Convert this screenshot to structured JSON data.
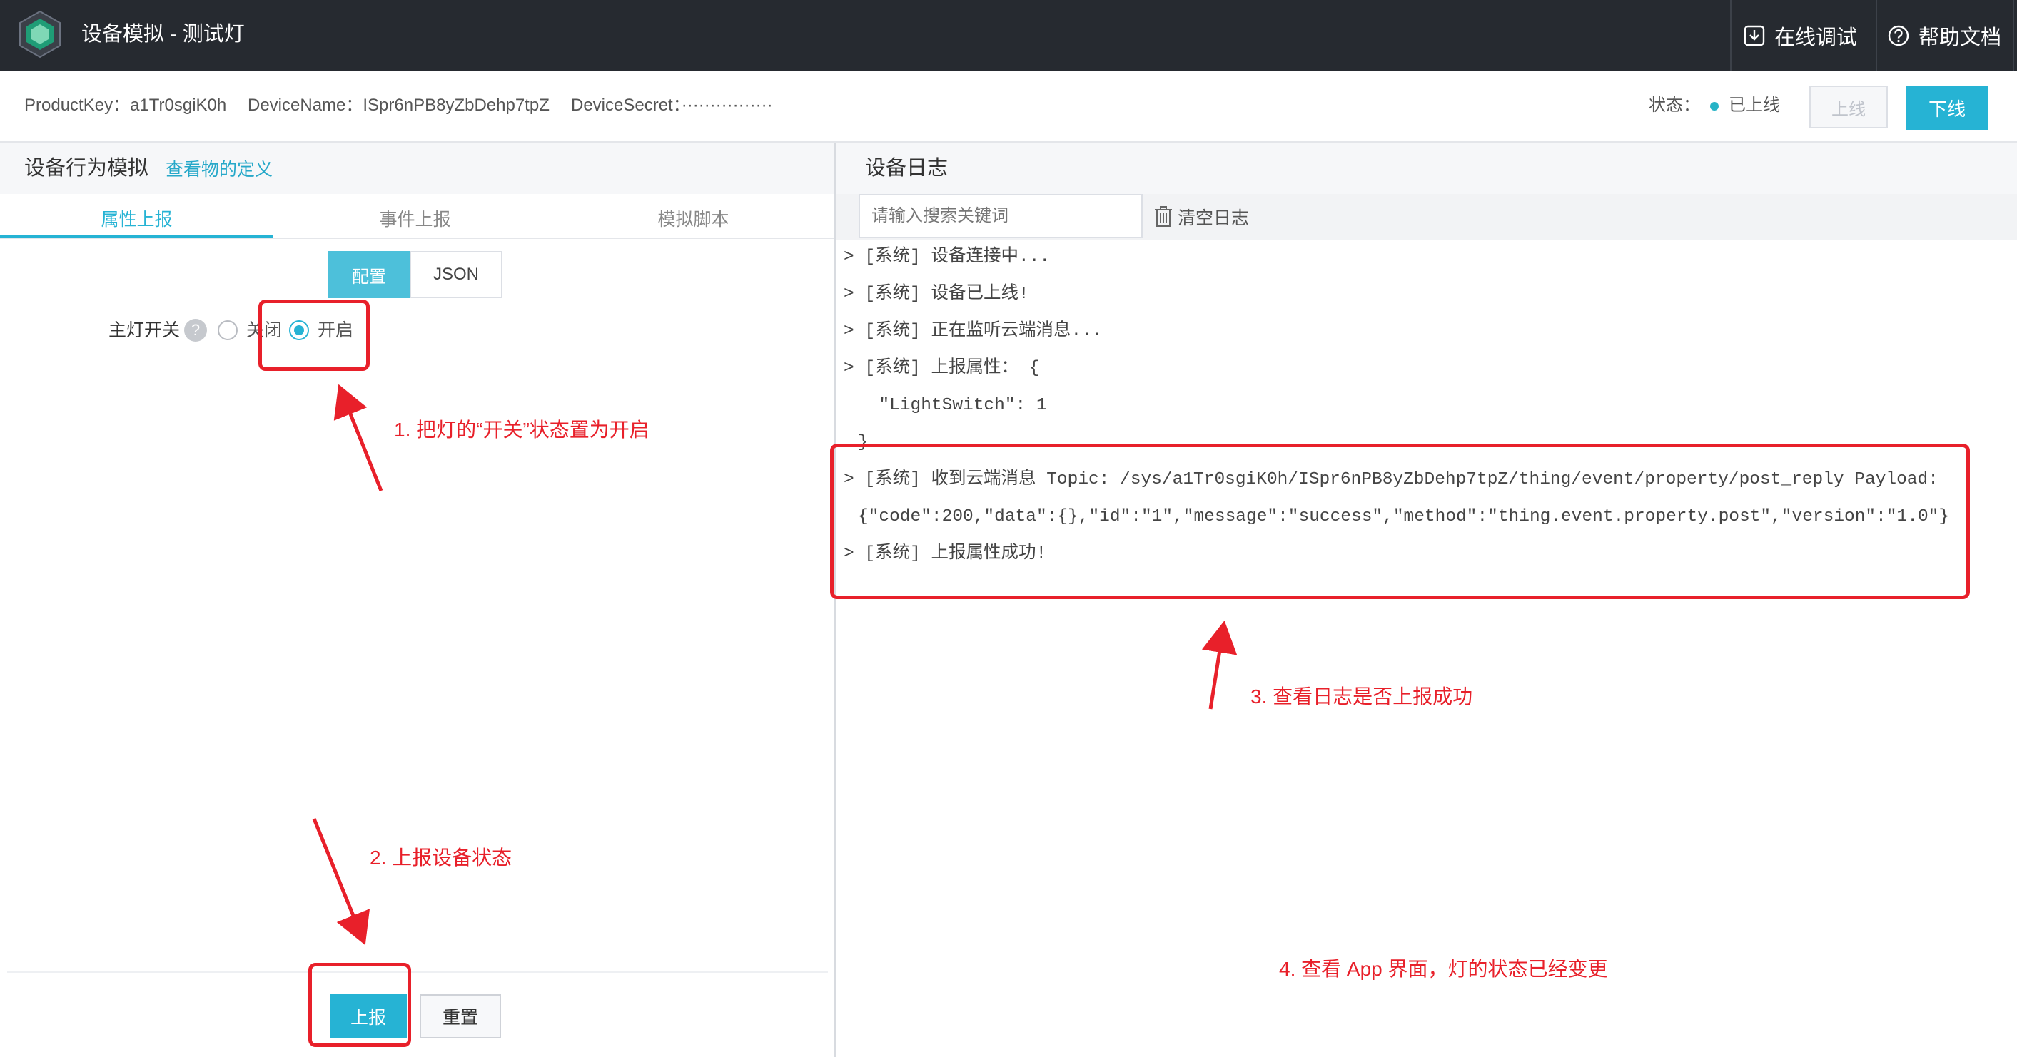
{
  "header": {
    "title": "设备模拟 - 测试灯",
    "online_debug": "在线调试",
    "help_docs": "帮助文档"
  },
  "device": {
    "product_key": "ProductKey：a1Tr0sgiK0h",
    "device_name": "DeviceName：ISpr6nPB8yZbDehp7tpZ",
    "device_secret": "DeviceSecret：················",
    "status_label": "状态：",
    "status_value": "已上线",
    "online_button": "上线",
    "offline_button": "下线"
  },
  "left_panel": {
    "title": "设备行为模拟",
    "thing_def_link": "查看物的定义",
    "tabs": [
      "属性上报",
      "事件上报",
      "模拟脚本"
    ],
    "active_tab": 0,
    "mode_config": "配置",
    "mode_json": "JSON",
    "field_label": "主灯开关",
    "help_icon": "?",
    "option_off": "关闭",
    "option_on": "开启",
    "selected_option": "开启",
    "report_button": "上报",
    "reset_button": "重置"
  },
  "right_panel": {
    "title": "设备日志",
    "search_placeholder": "请输入搜索关键词",
    "clear_log": "清空日志",
    "logs": [
      "> [系统] 设备连接中...",
      "> [系统] 设备已上线!",
      "> [系统] 正在监听云端消息...",
      "> [系统] 上报属性： {",
      "  \"LightSwitch\": 1",
      "}",
      "> [系统] 收到云端消息 Topic: /sys/a1Tr0sgiK0h/ISpr6nPB8yZbDehp7tpZ/thing/event/property/post_reply Payload:",
      "{\"code\":200,\"data\":{},\"id\":\"1\",\"message\":\"success\",\"method\":\"thing.event.property.post\",\"version\":\"1.0\"}",
      "> [系统] 上报属性成功!"
    ]
  },
  "annotations": {
    "step1": "1. 把灯的“开关”状态置为开启",
    "step2": "2. 上报设备状态",
    "step3": "3. 查看日志是否上报成功",
    "step4": "4. 查看 App 界面，灯的状态已经变更",
    "color": "#e8202a"
  },
  "colors": {
    "topbar": "#262a30",
    "accent": "#26b3d4"
  }
}
